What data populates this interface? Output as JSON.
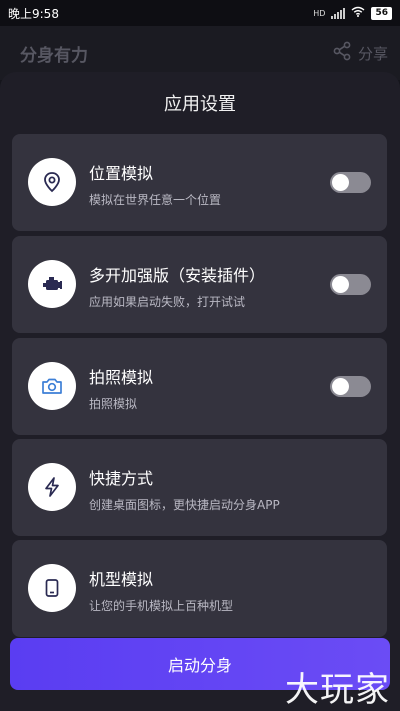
{
  "status_bar": {
    "time": "晚上9:58",
    "network": "HD",
    "battery": "56"
  },
  "background_header": {
    "title": "分身有力",
    "share_label": "分享",
    "share_icon": "share-icon"
  },
  "sheet": {
    "title": "应用设置",
    "items": [
      {
        "title": "位置模拟",
        "subtitle": "模拟在世界任意一个位置",
        "icon": "location-pin-icon",
        "toggle": "off"
      },
      {
        "title": "多开加强版（安装插件）",
        "subtitle": "应用如果启动失败，打开试试",
        "icon": "engine-icon",
        "toggle": "off"
      },
      {
        "title": "拍照模拟",
        "subtitle": "拍照模拟",
        "icon": "camera-icon",
        "toggle": "off"
      },
      {
        "title": "快捷方式",
        "subtitle": "创建桌面图标，更快捷启动分身APP",
        "icon": "lightning-icon"
      },
      {
        "title": "机型模拟",
        "subtitle": "让您的手机模拟上百种机型",
        "icon": "phone-icon"
      }
    ],
    "start_button_label": "启动分身"
  },
  "watermark": "大玩家",
  "colors": {
    "accent": "#5a3df2",
    "card_bg": "#34333e",
    "sheet_bg": "#1f1e27",
    "toggle_off": "#8b8a93"
  }
}
